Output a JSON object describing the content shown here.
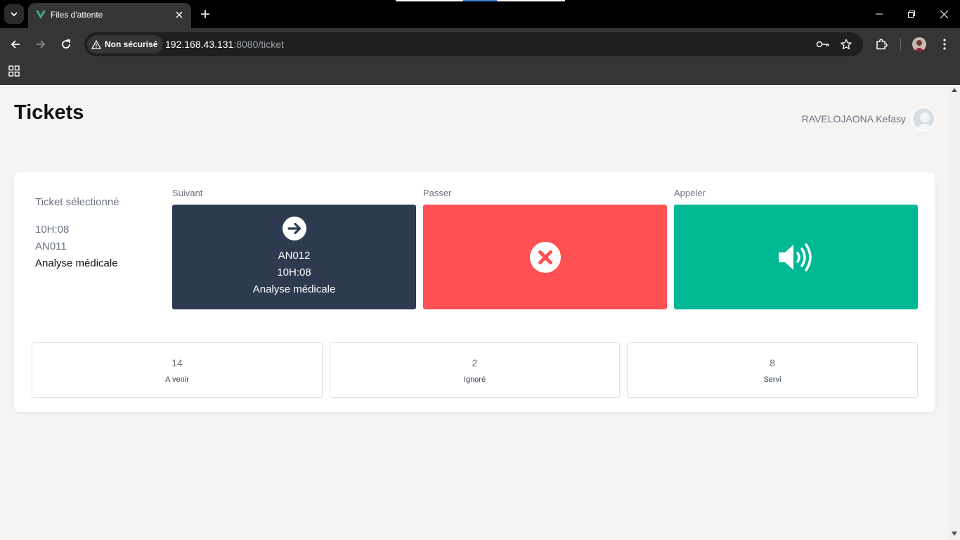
{
  "browser": {
    "tab_title": "Files d'attente",
    "security_label": "Non sécurisé",
    "url_host": "192.168.43.131",
    "url_rest": ":8080/ticket"
  },
  "page": {
    "title": "Tickets",
    "user_name": "RAVELOJAONA Kefasy"
  },
  "selected_ticket": {
    "heading": "Ticket sélectionné",
    "time": "10H:08",
    "code": "AN011",
    "service": "Analyse médicale"
  },
  "actions": {
    "next": {
      "label": "Suivant",
      "code": "AN012",
      "time": "10H:08",
      "service": "Analyse médicale",
      "color": "#2d3b50",
      "icon": "arrow-right-circle-icon"
    },
    "skip": {
      "label": "Passer",
      "color": "#ff5054",
      "icon": "x-circle-icon"
    },
    "call": {
      "label": "Appeler",
      "color": "#00b894",
      "icon": "speaker-volume-icon"
    }
  },
  "stats": [
    {
      "value": "14",
      "label": "A venir"
    },
    {
      "value": "2",
      "label": "Ignoré"
    },
    {
      "value": "8",
      "label": "Servi"
    }
  ]
}
